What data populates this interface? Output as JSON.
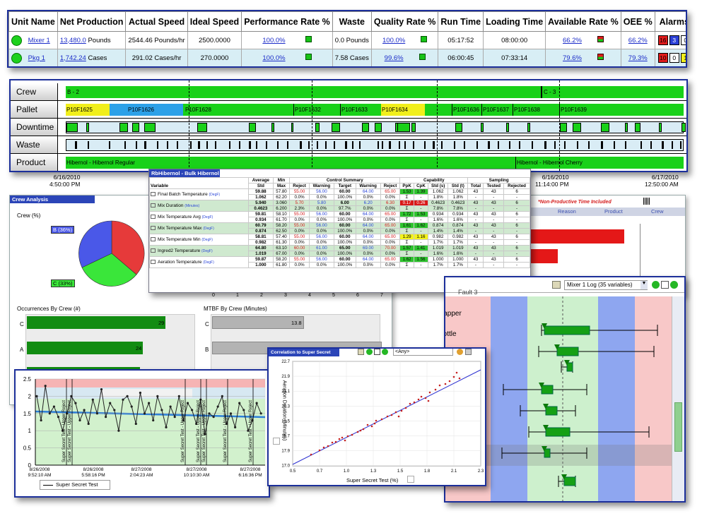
{
  "units": {
    "headers": [
      "Unit Name",
      "Net Production",
      "Actual Speed",
      "Ideal Speed",
      "Performance Rate %",
      "Waste",
      "Quality Rate %",
      "Run Time",
      "Loading Time",
      "Available Rate %",
      "OEE %",
      "Alarms"
    ],
    "rows": [
      {
        "name": "Mixer 1",
        "net": "13,480.0",
        "net_unit": "Pounds",
        "actual": "2544.46",
        "actual_unit": "Pounds/hr",
        "ideal": "2500.0000",
        "perf": "100.0%",
        "waste": "0.0",
        "waste_unit": "Pounds",
        "quality": "100.0%",
        "run": "05:17:52",
        "loading": "08:00:00",
        "avail": "66.2%",
        "oee": "66.2%",
        "alarms": [
          "16",
          "3",
          "0"
        ]
      },
      {
        "name": "Pkg 1",
        "net": "1,742.24",
        "net_unit": "Cases",
        "actual": "291.02",
        "actual_unit": "Cases/hr",
        "ideal": "270.0000",
        "perf": "100.0%",
        "waste": "7.58",
        "waste_unit": "Cases",
        "quality": "99.6%",
        "run": "06:00:45",
        "loading": "07:33:14",
        "avail": "79.6%",
        "oee": "79.3%",
        "alarms": [
          "10",
          "0",
          "1"
        ]
      }
    ]
  },
  "timeline": {
    "rows": [
      "Crew",
      "Pallet",
      "Downtime",
      "Waste",
      "Product"
    ],
    "crew": [
      "B - 2",
      "C - 3"
    ],
    "pallets": [
      "P10F1625",
      "P10F1626",
      "P10F1628",
      "P10F1632",
      "P10F1633",
      "P10F1634",
      "P10F1636",
      "P10F1637",
      "P10F1638",
      "P10F1639"
    ],
    "products": [
      "Hibernol - Hibernol Regular",
      "Hibernol - Hibernol Cherry"
    ],
    "axis": [
      {
        "d": "6/16/2010",
        "t": "4:50:00 PM"
      },
      {
        "d": "6/16/2010",
        "t": "11:14:00 PM"
      },
      {
        "d": "6/17/2010",
        "t": "12:50:00 AM"
      }
    ]
  },
  "bulk": {
    "title": "RbHibernol - Bulk Hibernol Regular",
    "groups": {
      "control": "Control Summary",
      "capability": "Capability",
      "sampling": "Sampling"
    },
    "cols": [
      "Variable",
      "Average",
      "Min",
      "Reject",
      "Warning",
      "Target",
      "Warning",
      "Reject",
      "PpK",
      "CpK",
      "Std (s)",
      "Std (t)",
      "Total",
      "Tested",
      "Rejected"
    ],
    "subcols": {
      "std": "Std",
      "max": "Max"
    },
    "rows": [
      {
        "name": "Final Batch Temperature",
        "unit": "(DegF)",
        "avg": "59.88",
        "std": "1.062",
        "min": "57.80",
        "max": "62.20",
        "rl": "55.00",
        "wl": "56.00",
        "t": "60.00",
        "wh": "64.00",
        "rh": "65.00",
        "p1": "0.0%",
        "p2": "0.0%",
        "p3": "100.0%",
        "p4": "0.0%",
        "p5": "0.0%",
        "ppk": "1.53",
        "cpk": "1.39",
        "ss": "1.062",
        "st": "1.062",
        "ssp": "1.8%",
        "stp": "1.8%",
        "tot": "43",
        "tes": "43",
        "rej": "6"
      },
      {
        "name": "Mix Duration",
        "unit": "(Minutes)",
        "avg": "5.940",
        "std": "0.4623",
        "min": "3.060",
        "max": "6.200",
        "rl": "5.70",
        "wl": "5.80",
        "t": "6.00",
        "wh": "6.20",
        "rh": "6.30",
        "p1": "2.3%",
        "p2": "0.0%",
        "p3": "97.7%",
        "p4": "0.0%",
        "p5": "0.0%",
        "ppk": "0.17",
        "cpk": "0.26",
        "ss": "0.4623",
        "st": "0.4623",
        "ssp": "7.8%",
        "stp": "7.8%",
        "tot": "43",
        "tes": "43",
        "rej": "6"
      },
      {
        "name": "Mix Temperature Avg",
        "unit": "(DegF)",
        "avg": "59.81",
        "std": "0.934",
        "min": "58.10",
        "max": "61.70",
        "rl": "55.00",
        "wl": "56.00",
        "t": "60.00",
        "wh": "64.00",
        "rh": "65.00",
        "p1": "0.0%",
        "p2": "0.0%",
        "p3": "100.0%",
        "p4": "0.0%",
        "p5": "0.0%",
        "ppk": "1.72",
        "cpk": "1.53",
        "ss": "0.934",
        "st": "0.934",
        "ssp": "1.6%",
        "stp": "1.6%",
        "tot": "43",
        "tes": "43",
        "rej": "6"
      },
      {
        "name": "Mix Temperature Max",
        "unit": "(DegF)",
        "avg": "60.79",
        "std": "0.874",
        "min": "58.20",
        "max": "62.50",
        "rl": "55.00",
        "wl": "56.00",
        "t": "60.00",
        "wh": "64.00",
        "rh": "65.00",
        "p1": "0.0%",
        "p2": "0.0%",
        "p3": "100.0%",
        "p4": "0.0%",
        "p5": "0.0%",
        "ppk": "1.61",
        "cpk": "1.62",
        "ss": "0.874",
        "st": "0.874",
        "ssp": "1.4%",
        "stp": "1.4%",
        "tot": "43",
        "tes": "43",
        "rej": "6"
      },
      {
        "name": "Mix Temperature Min",
        "unit": "(DegF)",
        "avg": "58.81",
        "std": "0.982",
        "min": "57.40",
        "max": "61.30",
        "rl": "55.00",
        "wl": "56.00",
        "t": "60.00",
        "wh": "64.00",
        "rh": "65.00",
        "p1": "0.0%",
        "p2": "0.0%",
        "p3": "100.0%",
        "p4": "0.0%",
        "p5": "0.0%",
        "ppk": "1.29",
        "cpk": "1.16",
        "ss": "0.982",
        "st": "0.982",
        "ssp": "1.7%",
        "stp": "1.7%",
        "tot": "43",
        "tes": "43",
        "rej": "6"
      },
      {
        "name": "Ingred2 Temperature",
        "unit": "(DegF)",
        "avg": "64.80",
        "std": "1.019",
        "min": "63.10",
        "max": "67.00",
        "rl": "60.00",
        "wl": "61.00",
        "t": "65.00",
        "wh": "69.00",
        "rh": "70.00",
        "p1": "0.0%",
        "p2": "0.0%",
        "p3": "100.0%",
        "p4": "0.0%",
        "p5": "0.0%",
        "ppk": "1.57",
        "cpk": "1.41",
        "ss": "1.019",
        "st": "1.019",
        "ssp": "1.6%",
        "stp": "1.6%",
        "tot": "43",
        "tes": "43",
        "rej": "6"
      },
      {
        "name": "Aeration Temperature",
        "unit": "(DegF)",
        "avg": "59.87",
        "std": "1.000",
        "min": "58.20",
        "max": "61.80",
        "rl": "55.00",
        "wl": "56.00",
        "t": "60.00",
        "wh": "64.00",
        "rh": "65.00",
        "p1": "0.0%",
        "p2": "0.0%",
        "p3": "100.0%",
        "p4": "0.0%",
        "p5": "0.0%",
        "ppk": "1.62",
        "cpk": "1.56",
        "ss": "1.000",
        "st": "1.000",
        "ssp": "1.7%",
        "stp": "1.7%",
        "tot": "43",
        "tes": "43",
        "rej": "6"
      }
    ]
  },
  "crew": {
    "title": "Crew Analysis",
    "pie_label": "Crew (%)",
    "b": "B (36%)",
    "c": "C (33%)",
    "occ_title": "Occurrences By Crew (#)",
    "mtbf_title": "MTBF By Crew (Minutes)",
    "occ": [
      {
        "c": "C",
        "v": "29"
      },
      {
        "c": "A",
        "v": "24"
      }
    ],
    "mtbf": [
      {
        "c": "C",
        "v": "13.8"
      },
      {
        "c": "B",
        "v": ""
      }
    ],
    "ticks": [
      "0",
      "1",
      "2",
      "3",
      "4",
      "5",
      "6",
      "7"
    ]
  },
  "rightA": {
    "note": "*Non-Productive Time Included",
    "tabs": [
      "Reason",
      "Product",
      "Crew"
    ]
  },
  "mixer": {
    "select": "Mixer 1 Log (35 variables)",
    "fault": "Fault 3",
    "labels": [
      "Capper",
      "Bottle"
    ]
  },
  "cc": {
    "yticks": [
      "2.5",
      "2",
      "1.5",
      "1",
      "0.5",
      "0"
    ],
    "xlabels": [
      {
        "d": "8/26/2008",
        "t": "9:52:10 AM"
      },
      {
        "d": "8/26/2008",
        "t": "5:58:16 PM"
      },
      {
        "d": "8/27/2008",
        "t": "2:04:23 AM"
      },
      {
        "d": "8/27/2008",
        "t": "10:10:30 AM"
      },
      {
        "d": "8/27/2008",
        "t": "6:16:36 PM"
      }
    ],
    "legend": "Super Secret Test",
    "marker": "Super Secret Test - Upper Reject"
  },
  "corr": {
    "title": "Correlation to Super Secret Test",
    "select": "<Any>",
    "xlabel": "Super Secret Test (%)",
    "ylabel": "Aeration Duration (Minutes)",
    "xticks": [
      "0.5",
      "0.7",
      "1.0",
      "1.3",
      "1.5",
      "1.8",
      "2.1",
      "2.3"
    ],
    "yticks": [
      "22.7",
      "21.9",
      "21.1",
      "20.3",
      "19.5",
      "18.7",
      "17.9",
      "17.0"
    ]
  }
}
